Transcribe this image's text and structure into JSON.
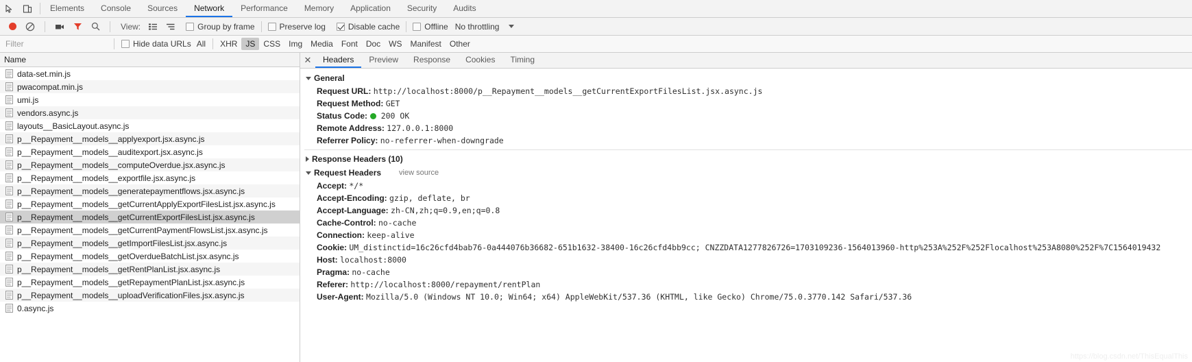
{
  "maintabs": {
    "icons": [
      {
        "name": "inspect-element-icon"
      },
      {
        "name": "device-toolbar-icon"
      }
    ],
    "tabs": [
      {
        "label": "Elements",
        "active": false
      },
      {
        "label": "Console",
        "active": false
      },
      {
        "label": "Sources",
        "active": false
      },
      {
        "label": "Network",
        "active": true
      },
      {
        "label": "Performance",
        "active": false
      },
      {
        "label": "Memory",
        "active": false
      },
      {
        "label": "Application",
        "active": false
      },
      {
        "label": "Security",
        "active": false
      },
      {
        "label": "Audits",
        "active": false
      }
    ]
  },
  "toolbar": {
    "record_title": "record-button",
    "clear_title": "clear-button",
    "screenshot_title": "capture-screenshots-button",
    "filter_title": "filter-button",
    "search_title": "search-button",
    "view_label": "View:",
    "group_by_frame": {
      "label": "Group by frame",
      "checked": false
    },
    "preserve_log": {
      "label": "Preserve log",
      "checked": false
    },
    "disable_cache": {
      "label": "Disable cache",
      "checked": true
    },
    "offline": {
      "label": "Offline",
      "checked": false
    },
    "throttling": "No throttling"
  },
  "filterbar": {
    "placeholder": "Filter",
    "value": "",
    "hide_data_urls": {
      "label": "Hide data URLs",
      "checked": false
    },
    "types": [
      {
        "label": "All",
        "selected": false
      },
      {
        "label": "XHR",
        "selected": false
      },
      {
        "label": "JS",
        "selected": true
      },
      {
        "label": "CSS",
        "selected": false
      },
      {
        "label": "Img",
        "selected": false
      },
      {
        "label": "Media",
        "selected": false
      },
      {
        "label": "Font",
        "selected": false
      },
      {
        "label": "Doc",
        "selected": false
      },
      {
        "label": "WS",
        "selected": false
      },
      {
        "label": "Manifest",
        "selected": false
      },
      {
        "label": "Other",
        "selected": false
      }
    ]
  },
  "requests": {
    "column_name": "Name",
    "rows": [
      {
        "name": "data-set.min.js",
        "selected": false
      },
      {
        "name": "pwacompat.min.js",
        "selected": false
      },
      {
        "name": "umi.js",
        "selected": false
      },
      {
        "name": "vendors.async.js",
        "selected": false
      },
      {
        "name": "layouts__BasicLayout.async.js",
        "selected": false
      },
      {
        "name": "p__Repayment__models__applyexport.jsx.async.js",
        "selected": false
      },
      {
        "name": "p__Repayment__models__auditexport.jsx.async.js",
        "selected": false
      },
      {
        "name": "p__Repayment__models__computeOverdue.jsx.async.js",
        "selected": false
      },
      {
        "name": "p__Repayment__models__exportfile.jsx.async.js",
        "selected": false
      },
      {
        "name": "p__Repayment__models__generatepaymentflows.jsx.async.js",
        "selected": false
      },
      {
        "name": "p__Repayment__models__getCurrentApplyExportFilesList.jsx.async.js",
        "selected": false
      },
      {
        "name": "p__Repayment__models__getCurrentExportFilesList.jsx.async.js",
        "selected": true
      },
      {
        "name": "p__Repayment__models__getCurrentPaymentFlowsList.jsx.async.js",
        "selected": false
      },
      {
        "name": "p__Repayment__models__getImportFilesList.jsx.async.js",
        "selected": false
      },
      {
        "name": "p__Repayment__models__getOverdueBatchList.jsx.async.js",
        "selected": false
      },
      {
        "name": "p__Repayment__models__getRentPlanList.jsx.async.js",
        "selected": false
      },
      {
        "name": "p__Repayment__models__getRepaymentPlanList.jsx.async.js",
        "selected": false
      },
      {
        "name": "p__Repayment__models__uploadVerificationFiles.jsx.async.js",
        "selected": false
      },
      {
        "name": "0.async.js",
        "selected": false
      }
    ]
  },
  "detail": {
    "close_label": "✕",
    "tabs": [
      {
        "label": "Headers",
        "active": true
      },
      {
        "label": "Preview",
        "active": false
      },
      {
        "label": "Response",
        "active": false
      },
      {
        "label": "Cookies",
        "active": false
      },
      {
        "label": "Timing",
        "active": false
      }
    ],
    "general": {
      "title": "General",
      "request_url_key": "Request URL:",
      "request_url_value": "http://localhost:8000/p__Repayment__models__getCurrentExportFilesList.jsx.async.js",
      "request_method_key": "Request Method:",
      "request_method_value": "GET",
      "status_code_key": "Status Code:",
      "status_code_value": "200 OK",
      "remote_address_key": "Remote Address:",
      "remote_address_value": "127.0.0.1:8000",
      "referrer_policy_key": "Referrer Policy:",
      "referrer_policy_value": "no-referrer-when-downgrade"
    },
    "response_headers": {
      "title": "Response Headers (10)"
    },
    "request_headers": {
      "title": "Request Headers",
      "view_source": "view source",
      "items": [
        {
          "key": "Accept:",
          "value": "*/*"
        },
        {
          "key": "Accept-Encoding:",
          "value": "gzip, deflate, br"
        },
        {
          "key": "Accept-Language:",
          "value": "zh-CN,zh;q=0.9,en;q=0.8"
        },
        {
          "key": "Cache-Control:",
          "value": "no-cache"
        },
        {
          "key": "Connection:",
          "value": "keep-alive"
        },
        {
          "key": "Cookie:",
          "value": "UM_distinctid=16c26cfd4bab76-0a444076b36682-651b1632-38400-16c26cfd4bb9cc; CNZZDATA1277826726=1703109236-1564013960-http%253A%252F%252Flocalhost%253A8080%252F%7C1564019432"
        },
        {
          "key": "Host:",
          "value": "localhost:8000"
        },
        {
          "key": "Pragma:",
          "value": "no-cache"
        },
        {
          "key": "Referer:",
          "value": "http://localhost:8000/repayment/rentPlan"
        },
        {
          "key": "User-Agent:",
          "value": "Mozilla/5.0 (Windows NT 10.0; Win64; x64) AppleWebKit/537.36 (KHTML, like Gecko) Chrome/75.0.3770.142 Safari/537.36"
        }
      ]
    }
  },
  "watermark": "https://blog.csdn.net/ThisEqualThis",
  "colors": {
    "accent": "#1a73e8",
    "record": "#e33e2b",
    "status_ok": "#25a928",
    "filter_active": "#e33e2b"
  }
}
